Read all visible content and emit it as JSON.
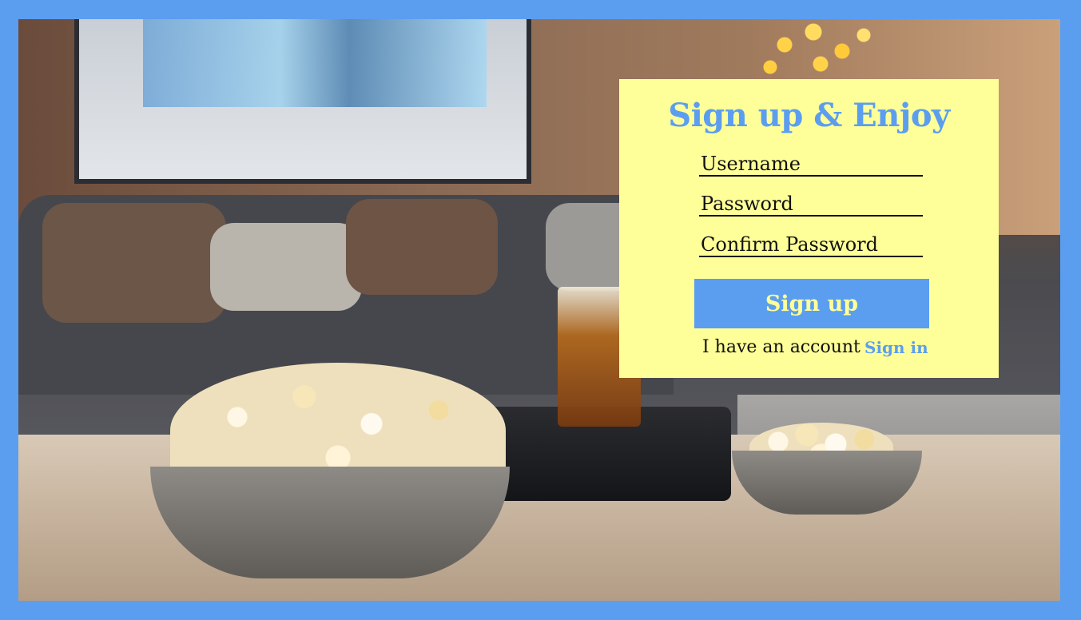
{
  "colors": {
    "frame_border": "#5b9ef0",
    "card_background": "#ffff99",
    "accent": "#5b9ef0",
    "button_text": "#ffff99"
  },
  "signup": {
    "title": "Sign up & Enjoy",
    "username_placeholder": "Username",
    "password_placeholder": "Password",
    "confirm_placeholder": "Confirm Password",
    "submit_label": "Sign up",
    "account_text": "I have an account",
    "signin_label": "Sign in"
  }
}
